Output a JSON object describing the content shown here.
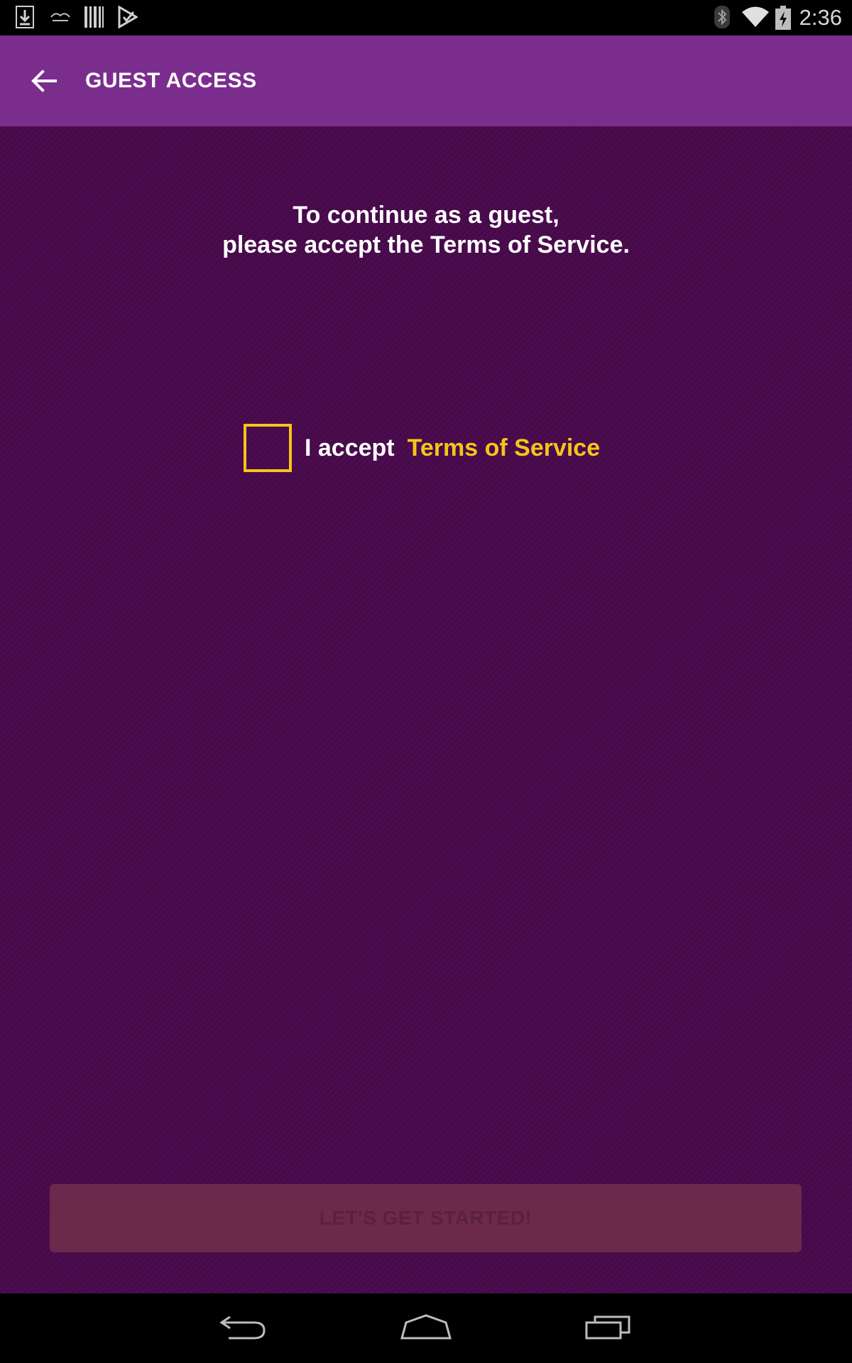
{
  "status_bar": {
    "time": "2:36",
    "left_icons": [
      "download-icon",
      "notification-app-icon",
      "barcode-icon",
      "play-store-icon"
    ],
    "right_icons": [
      "bluetooth-icon",
      "wifi-icon",
      "battery-charging-icon"
    ]
  },
  "app_bar": {
    "title": "GUEST ACCESS",
    "back_icon": "arrow-back-icon",
    "color": "#7b2d8e"
  },
  "content": {
    "intro_line1": "To continue as a guest,",
    "intro_line2": "please accept the Terms of Service.",
    "accept_label": "I accept",
    "tos_link": "Terms of Service",
    "checkbox_checked": false,
    "start_button_label": "LET'S GET STARTED!",
    "start_button_enabled": false,
    "background_color": "#47094a",
    "accent_color": "#f5c518"
  },
  "nav_bar": {
    "buttons": [
      "back-nav-icon",
      "home-nav-icon",
      "recents-nav-icon"
    ]
  }
}
